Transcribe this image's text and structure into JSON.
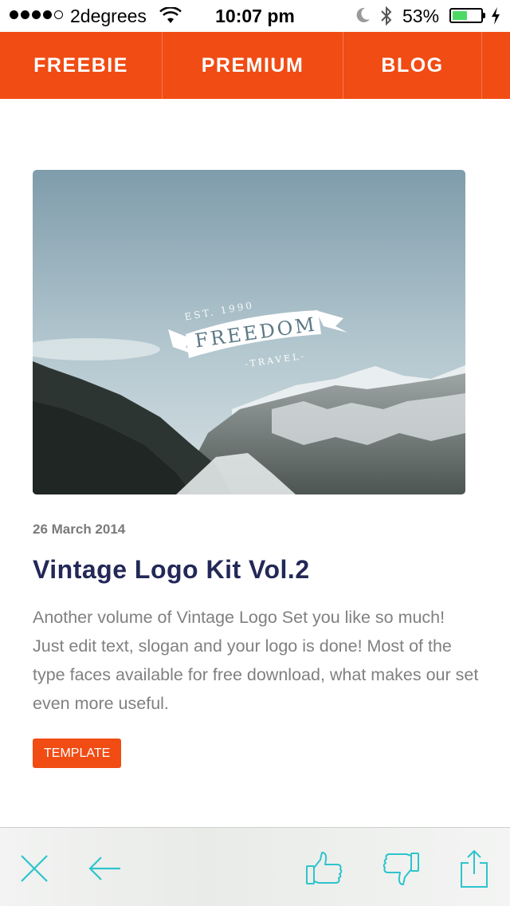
{
  "status_bar": {
    "carrier": "2degrees",
    "time": "10:07 pm",
    "battery_percent": "53%",
    "battery_level": 0.53,
    "signal_bars": 4,
    "signal_max": 5
  },
  "nav": {
    "items": [
      "FREEBIE",
      "PREMIUM",
      "BLOG",
      ""
    ]
  },
  "article": {
    "image": {
      "logo_est": "EST. 1990",
      "logo_name": "FREEDOM",
      "logo_sub": "-TRAVEL-"
    },
    "date": "26 March 2014",
    "title": "Vintage Logo Kit Vol.2",
    "description": "Another volume of Vintage Logo Set you like so much! Just edit text, slogan and your logo is done! Most of the type faces available for free download, what makes our set even more useful.",
    "tag": "TEMPLATE"
  },
  "toolbar": {
    "icons": [
      "close-icon",
      "back-arrow-icon",
      "thumbs-up-icon",
      "thumbs-down-icon",
      "share-icon"
    ]
  },
  "colors": {
    "accent": "#f04c14",
    "title": "#232858",
    "toolbar_icon": "#2ec4cc"
  }
}
